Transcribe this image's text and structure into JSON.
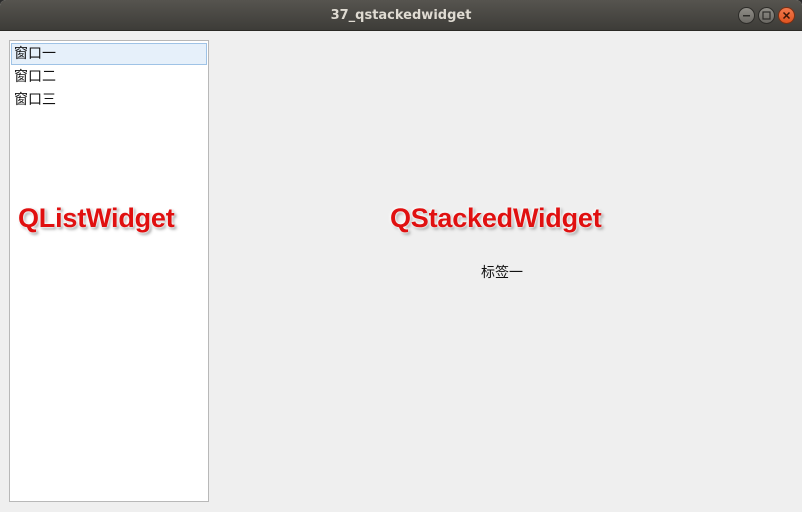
{
  "window": {
    "title": "37_qstackedwidget"
  },
  "list": {
    "items": [
      {
        "label": "窗口一",
        "selected": true
      },
      {
        "label": "窗口二",
        "selected": false
      },
      {
        "label": "窗口三",
        "selected": false
      }
    ]
  },
  "annotations": {
    "list_widget": "QListWidget",
    "stacked_widget": "QStackedWidget"
  },
  "stack": {
    "current_label": "标签一"
  },
  "colors": {
    "annotation": "#e01010",
    "selection_bg": "#e6f0fa",
    "titlebar": "#46453f",
    "close_button": "#e9612f"
  }
}
